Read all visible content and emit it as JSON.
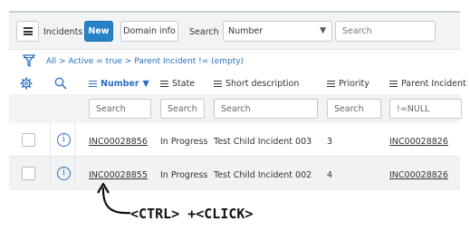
{
  "toolbar": {
    "title": "Incidents",
    "new_label": "New",
    "domain_label": "Domain info",
    "search_label": "Search",
    "search_field_value": "Number",
    "search_input_placeholder": "Search"
  },
  "breadcrumb": {
    "all": "All",
    "sep1": ">",
    "active": "Active = true",
    "sep2": ">",
    "parent": "Parent Incident != (empty)"
  },
  "columns": [
    {
      "label": "Number",
      "sorted": "desc",
      "search": "Search"
    },
    {
      "label": "State",
      "search": "Search"
    },
    {
      "label": "Short description",
      "search": "Search"
    },
    {
      "label": "Priority",
      "search": "Search"
    },
    {
      "label": "Parent Incident",
      "search": "!=NULL"
    }
  ],
  "rows": [
    {
      "number": "INC00028856",
      "state": "In Progress",
      "desc": "Test Child Incident 003",
      "priority": "3",
      "parent": "INC00028826"
    },
    {
      "number": "INC00028855",
      "state": "In Progress",
      "desc": "Test Child Incident 002",
      "priority": "4",
      "parent": "INC00028826"
    }
  ],
  "annotation": "<CTRL> +<CLICK>",
  "colors": {
    "accent": "#2683c9",
    "link": "#2a6fbc",
    "toolbar_bg": "#f1f3f5"
  },
  "icons": [
    "menu-icon",
    "sort-desc-icon",
    "filter-icon",
    "gear-icon",
    "search-icon",
    "info-icon",
    "arrow-icon"
  ]
}
